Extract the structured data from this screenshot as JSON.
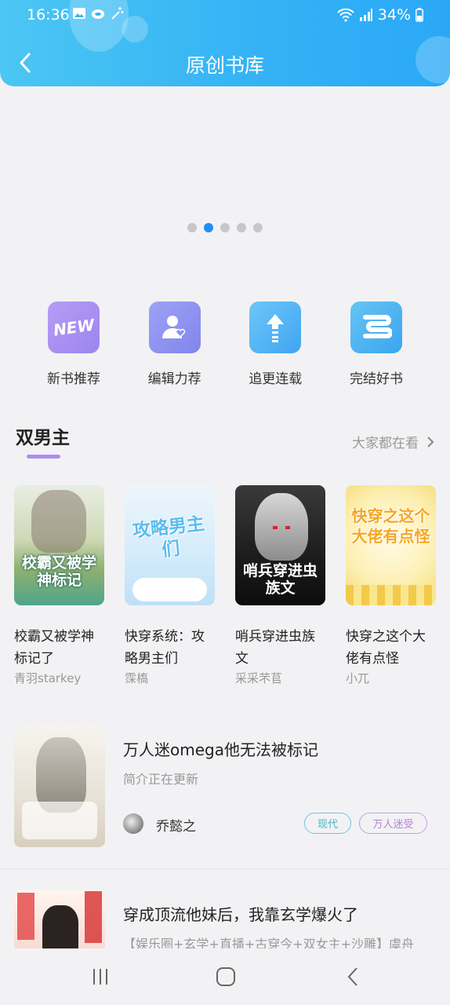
{
  "status_bar": {
    "time": "16:36",
    "battery": "34%"
  },
  "header": {
    "title": "原创书库"
  },
  "banner": {
    "dot_count": 5,
    "active_index": 1
  },
  "categories": [
    {
      "label": "新书推荐",
      "icon": "new-icon",
      "badge_text": "NEW",
      "color": "#a78bf0"
    },
    {
      "label": "编辑力荐",
      "icon": "editor-icon",
      "color": "#8f95f2"
    },
    {
      "label": "追更连载",
      "icon": "update-arrow-icon",
      "color": "#5ab8f5"
    },
    {
      "label": "完结好书",
      "icon": "finished-book-icon",
      "color": "#4cb6f1"
    }
  ],
  "section": {
    "title": "双男主",
    "more": "大家都在看"
  },
  "grid_books": [
    {
      "title": "校霸又被学神标记了",
      "author": "青羽starkey",
      "cover_text": "校霸又被学神标记"
    },
    {
      "title": "快穿系统：攻略男主们",
      "author": "霂槗",
      "cover_text": "攻略男主们"
    },
    {
      "title": "哨兵穿进虫族文",
      "author": "采采芣苢",
      "cover_text": "哨兵穿进虫族文"
    },
    {
      "title": "快穿之这个大佬有点怪",
      "author": "小兀",
      "cover_text": "快穿之这个大佬有点怪"
    }
  ],
  "list_books": [
    {
      "title": "万人迷omega他无法被标记",
      "desc": "简介正在更新",
      "author": "乔懿之",
      "tags": [
        "现代",
        "万人迷受"
      ]
    },
    {
      "title": "穿成顶流他妹后，我靠玄学爆火了",
      "desc": "【娱乐圈+玄学+直播+古穿今+双女主+沙雕】虞舟"
    }
  ]
}
